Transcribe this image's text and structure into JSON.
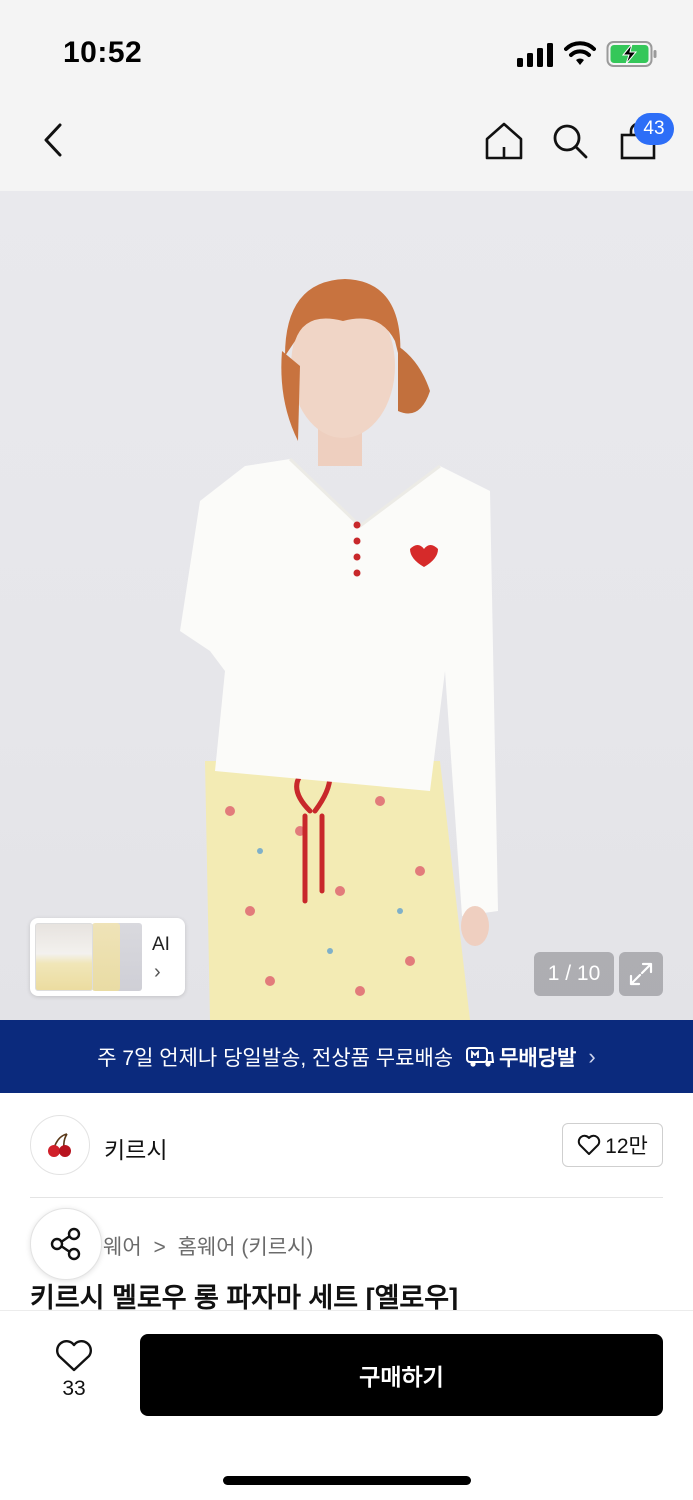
{
  "status_bar": {
    "time": "10:52"
  },
  "nav": {
    "icons": [
      "chevron-left-icon",
      "home-icon",
      "search-icon",
      "shopping-bag-icon"
    ],
    "cart_count": "43"
  },
  "product_image": {
    "ai_label": "AI",
    "ai_chevron": "›",
    "page_counter": "1 / 10"
  },
  "delivery_banner": {
    "text": "주 7일 언제나 당일발송, 전상품 무료배송",
    "logo_text": "무배당발",
    "chevron": "›"
  },
  "brand": {
    "name": "키르시",
    "likes": "12만"
  },
  "breadcrumb": {
    "first": "웨어",
    "separator": ">",
    "second": "홈웨어 (키르시)"
  },
  "product": {
    "title": "키르시 멜로우 롱 파자마 세트 [옐로우]"
  },
  "bottom_bar": {
    "wish_count": "33",
    "buy_label": "구매하기"
  },
  "colors": {
    "banner": "#0b2a7d",
    "badge": "#2d6ef7",
    "buy_button": "#000000"
  }
}
